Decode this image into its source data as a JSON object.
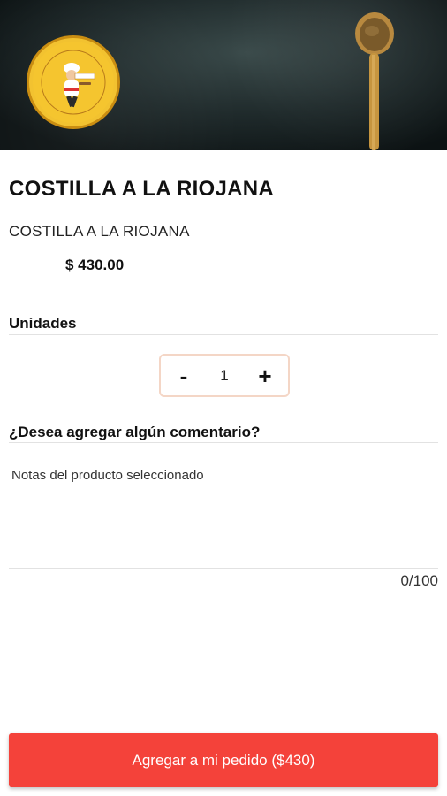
{
  "product": {
    "title": "COSTILLA A LA RIOJANA",
    "description": "COSTILLA A LA RIOJANA",
    "price": "$ 430.00"
  },
  "quantity": {
    "label": "Unidades",
    "minus": "-",
    "plus": "+",
    "value": "1"
  },
  "comment": {
    "label": "¿Desea agregar algún comentario?",
    "placeholder": "Notas del producto seleccionado",
    "counter": "0/100"
  },
  "cta": {
    "label": "Agregar a mi pedido ($430)",
    "color": "#f4423a"
  },
  "hero": {
    "logo_icon": "restaurant-logo-icon",
    "spoon_icon": "wooden-spoon-icon"
  }
}
